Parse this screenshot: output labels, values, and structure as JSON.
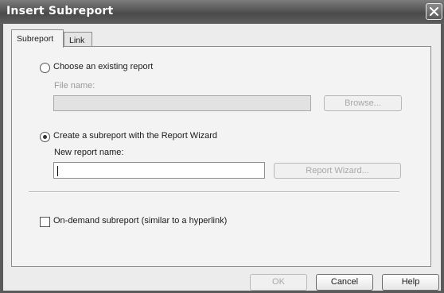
{
  "window": {
    "title": "Insert Subreport"
  },
  "tabs": [
    {
      "label": "Subreport"
    },
    {
      "label": "Link"
    }
  ],
  "existing": {
    "radio_label": "Choose an existing report",
    "file_name_label": "File name:",
    "file_name_value": "",
    "browse_label": "Browse..."
  },
  "wizard": {
    "radio_label": "Create a subreport with the Report Wizard",
    "new_name_label": "New report name:",
    "new_name_value": "",
    "wizard_button_label": "Report Wizard..."
  },
  "ondemand": {
    "label": "On-demand subreport (similar to a hyperlink)"
  },
  "footer": {
    "ok_label": "OK",
    "cancel_label": "Cancel",
    "help_label": "Help"
  }
}
